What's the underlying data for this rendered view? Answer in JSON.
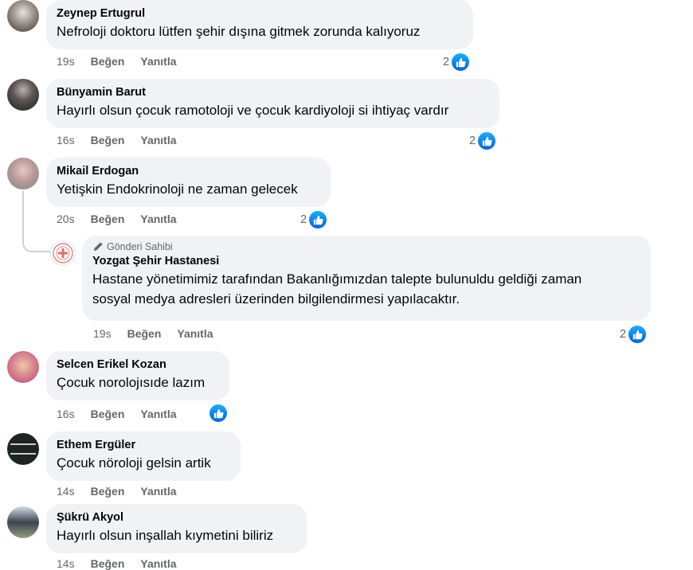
{
  "comments": [
    {
      "name": "Zeynep Ertugrul",
      "text": "Nefroloji doktoru lütfen şehir dışına gitmek zorunda kalıyoruz",
      "time": "19s",
      "like": "Beğen",
      "reply": "Yanıtla",
      "reactions": "2"
    },
    {
      "name": "Bünyamin Barut",
      "text": "Hayırlı olsun çocuk ramotoloji ve çocuk kardiyoloji si ihtiyaç vardır",
      "time": "16s",
      "like": "Beğen",
      "reply": "Yanıtla",
      "reactions": "2"
    },
    {
      "name": "Mikail Erdogan",
      "text": "Yetişkin Endokrinoloji ne zaman gelecek",
      "time": "20s",
      "like": "Beğen",
      "reply": "Yanıtla",
      "reactions": "2"
    },
    {
      "name": "Selcen Erikel Kozan",
      "text": "Çocuk norolojısıde lazım",
      "time": "16s",
      "like": "Beğen",
      "reply": "Yanıtla",
      "reactions": ""
    },
    {
      "name": "Ethem Ergüler",
      "text": "Çocuk nöroloji gelsin artik",
      "time": "14s",
      "like": "Beğen",
      "reply": "Yanıtla",
      "reactions": ""
    },
    {
      "name": "Şükrü Akyol",
      "text": "Hayırlı olsun inşallah kıymetini biliriz",
      "time": "14s",
      "like": "Beğen",
      "reply": "Yanıtla",
      "reactions": ""
    }
  ],
  "reply": {
    "badge": "Gönderi Sahibi",
    "name": "Yozgat Şehir Hastanesi",
    "line1": "Hastane yönetimimiz tarafından Bakanlığımızdan talepte bulunuldu geldiği zaman",
    "line2": "sosyal medya adresleri üzerinden bilgilendirmesi yapılacaktır.",
    "time": "19s",
    "like": "Beğen",
    "reply": "Yanıtla",
    "reactions": "2"
  },
  "colors": {
    "bubble": "#f0f2f5",
    "meta": "#65676b",
    "like_blue": "#0866ff"
  },
  "icons": {
    "like": "thumbs-up-icon",
    "author": "pencil-icon"
  }
}
